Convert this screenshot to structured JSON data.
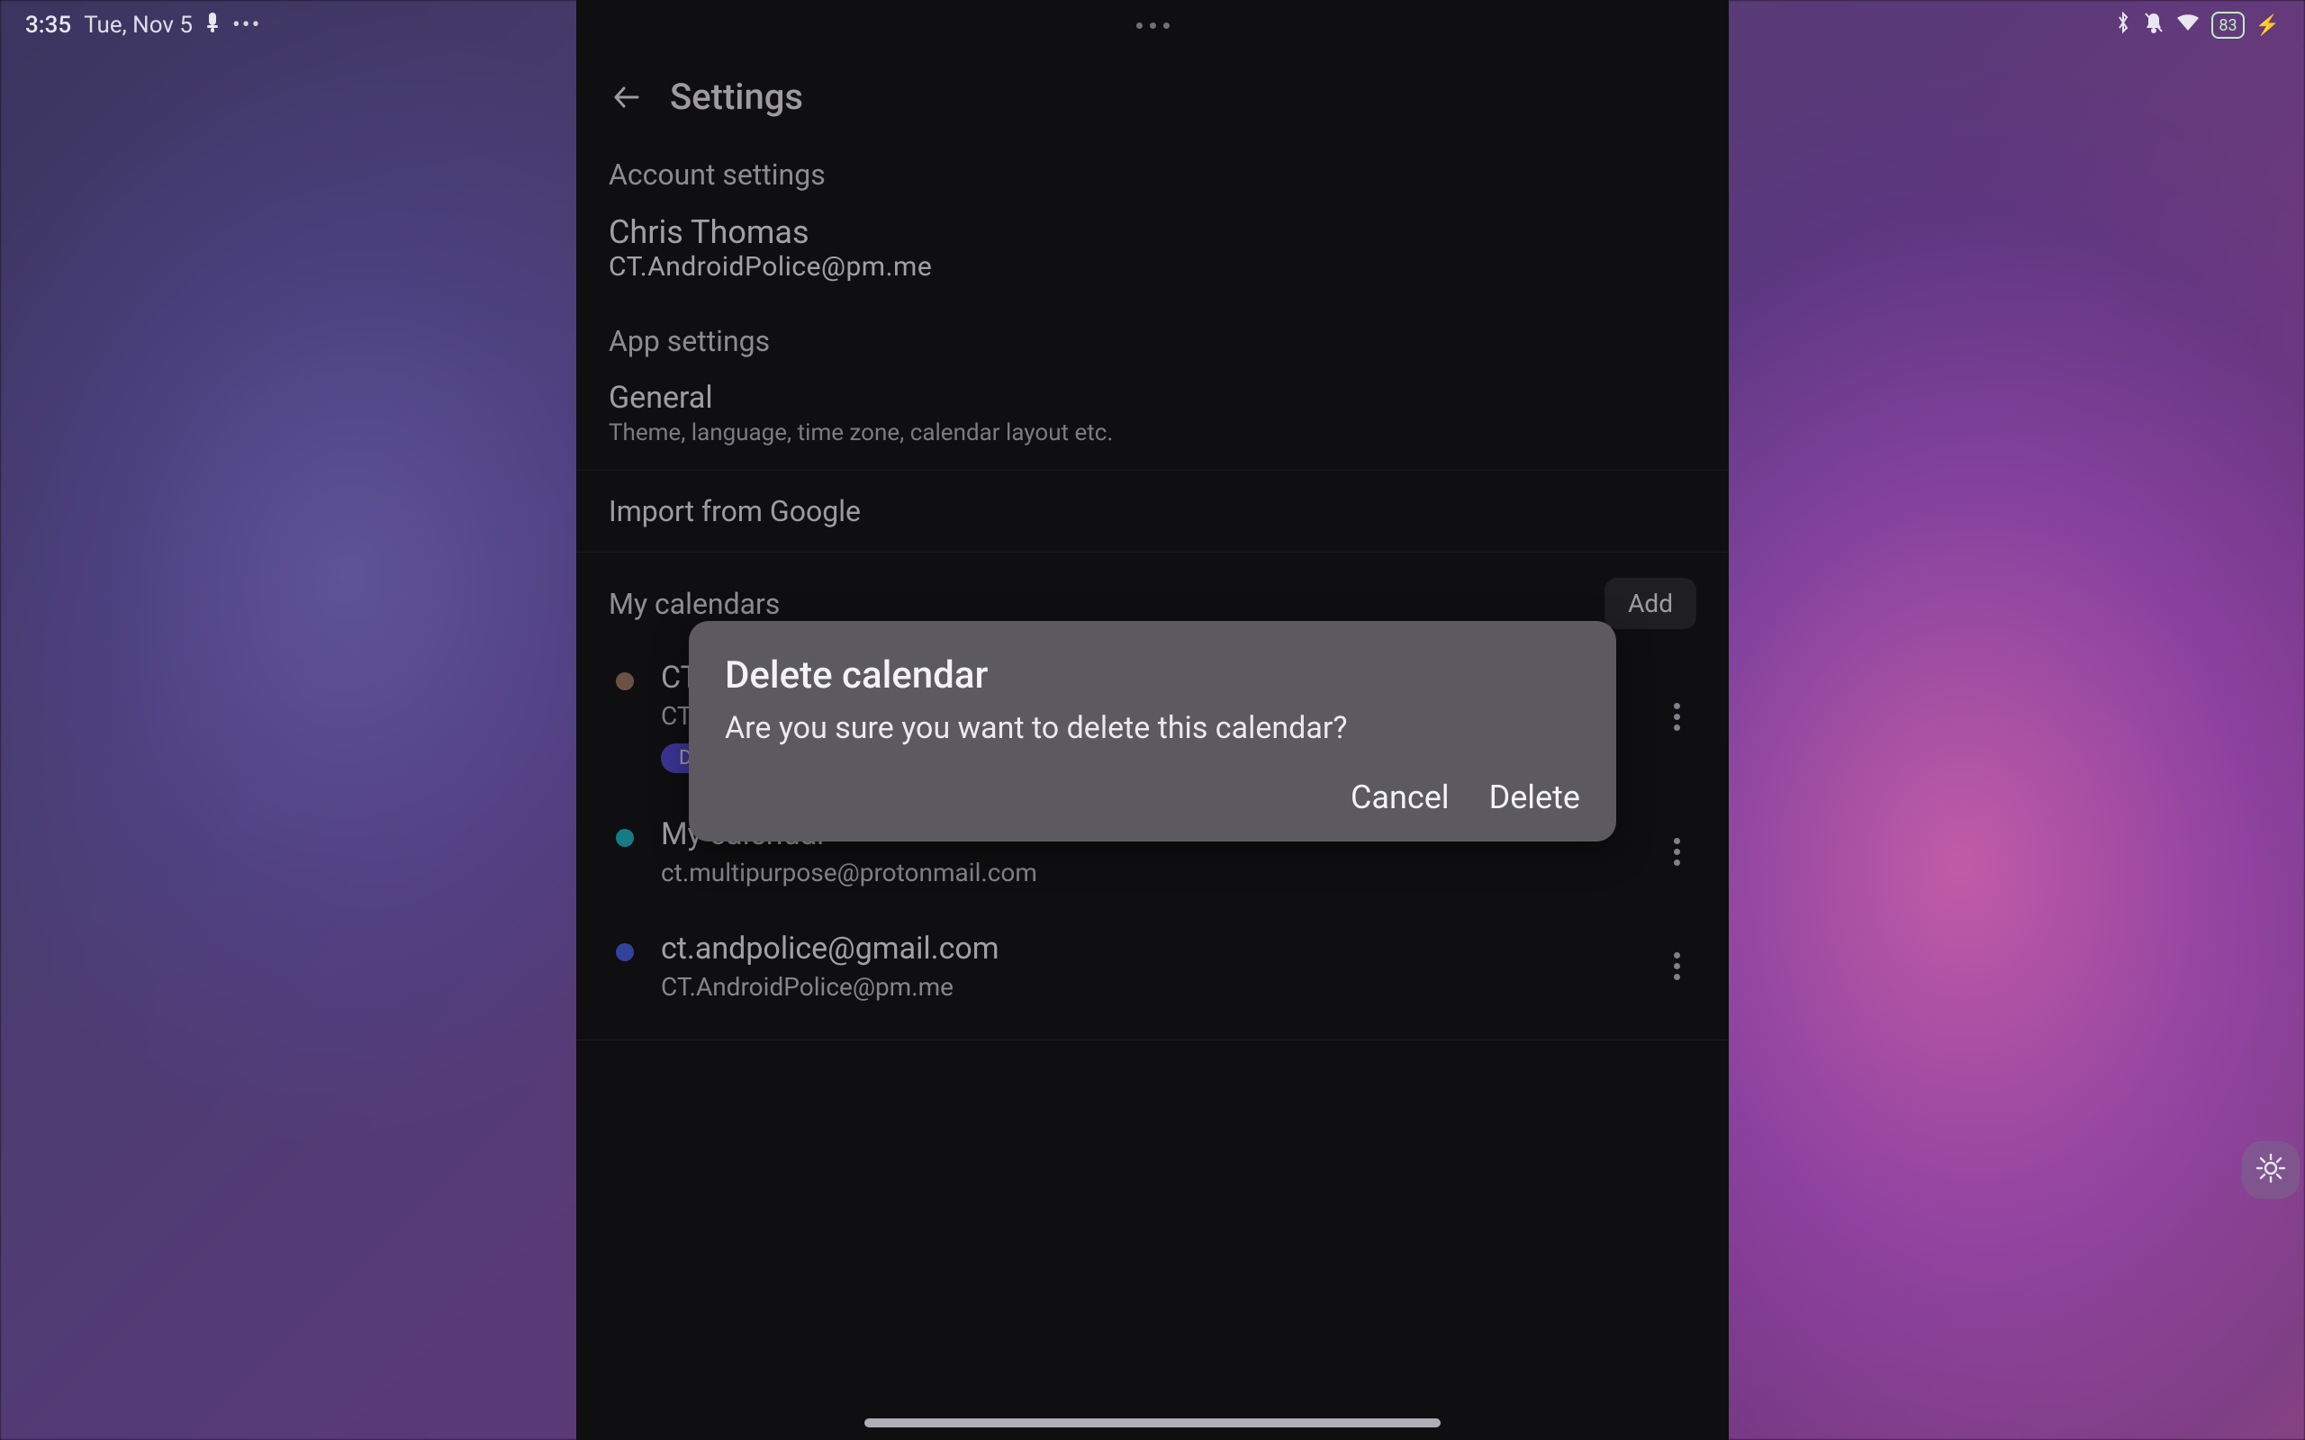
{
  "status": {
    "time": "3:35",
    "date": "Tue, Nov 5",
    "battery": "83"
  },
  "header": {
    "title": "Settings"
  },
  "account": {
    "heading": "Account settings",
    "name": "Chris Thomas",
    "email": "CT.AndroidPolice@pm.me"
  },
  "app_settings": {
    "heading": "App settings",
    "general_title": "General",
    "general_sub": "Theme, language, time zone, calendar layout etc."
  },
  "import": {
    "label": "Import from Google"
  },
  "calendars": {
    "heading": "My calendars",
    "add_label": "Add",
    "items": [
      {
        "name": "CT Calendar",
        "sub": "CT.AndroidPolice@pm.me",
        "badge": "Default",
        "color": "#a07a63"
      },
      {
        "name": "My calendar",
        "sub": "ct.multipurpose@protonmail.com",
        "color": "#1fb7c5"
      },
      {
        "name": "ct.andpolice@gmail.com",
        "sub": "CT.AndroidPolice@pm.me",
        "color": "#4a63e6"
      }
    ]
  },
  "modal": {
    "title": "Delete calendar",
    "body": "Are you sure you want to delete this calendar?",
    "cancel": "Cancel",
    "confirm": "Delete"
  }
}
